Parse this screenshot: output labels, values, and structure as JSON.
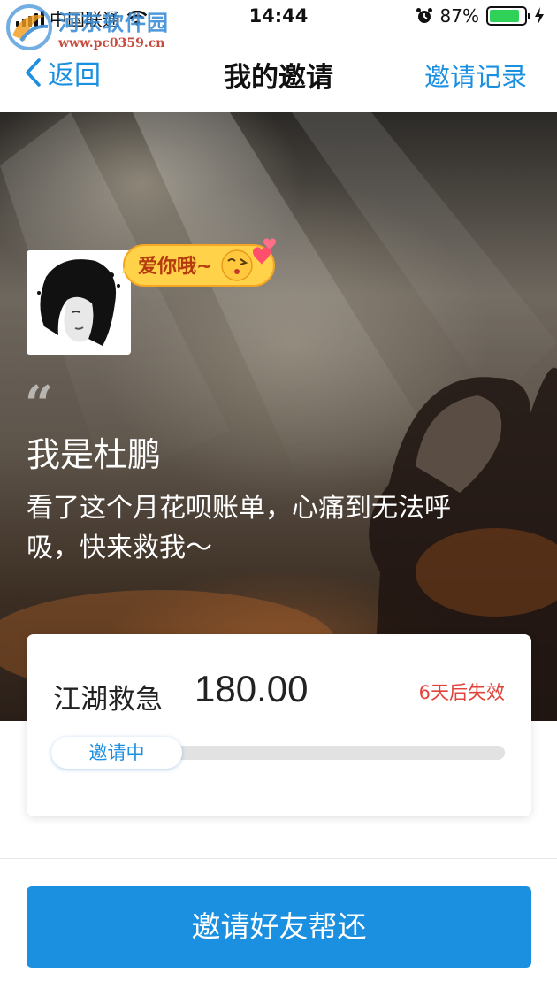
{
  "status_bar": {
    "carrier": "中国联通",
    "time": "14:44",
    "battery": "87%",
    "battery_level": 0.87,
    "icons": [
      "signal-icon",
      "wifi-icon",
      "alarm-icon",
      "battery-icon",
      "charging-bolt-icon"
    ]
  },
  "watermark": {
    "title": "河东软件园",
    "url": "www.pc0359.cn"
  },
  "nav": {
    "back_label": "返回",
    "title": "我的邀请",
    "right_label": "邀请记录"
  },
  "hero": {
    "badge_text": "爱你哦~",
    "quote_mark": "“",
    "name": "我是杜鹏",
    "message": "看了这个月花呗账单，心痛到无法呼吸，快来救我～"
  },
  "card": {
    "label": "江湖救急",
    "amount": "180.00",
    "expiry": "6天后失效",
    "status": "邀请中"
  },
  "cta": {
    "label": "邀请好友帮还"
  },
  "colors": {
    "accent": "#1b8fe0",
    "warning": "#e0443a",
    "battery": "#2fd158"
  }
}
